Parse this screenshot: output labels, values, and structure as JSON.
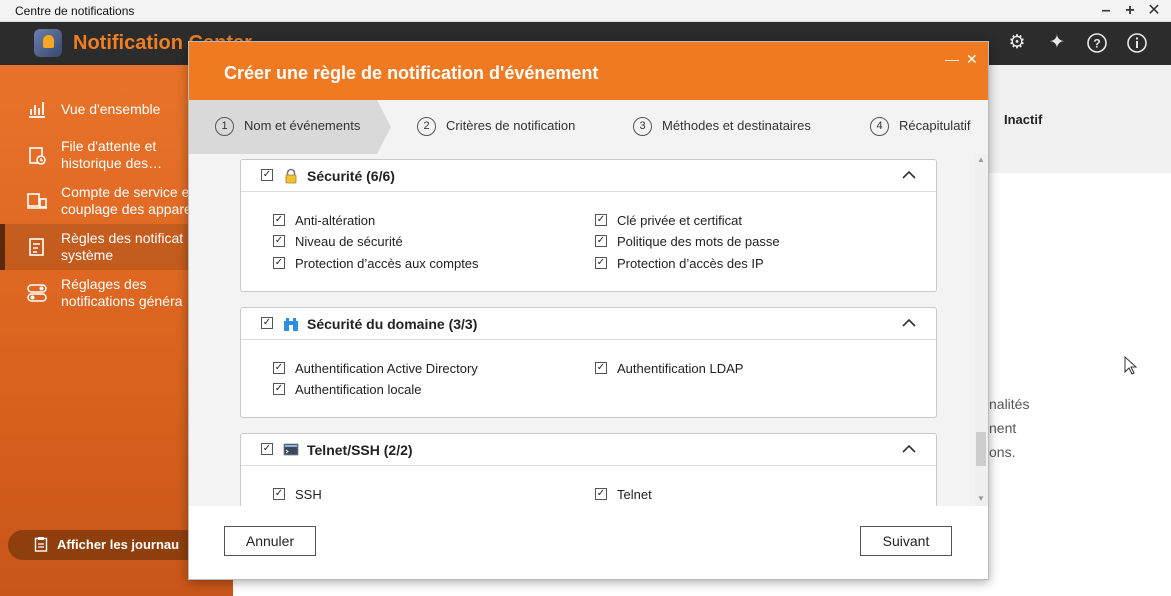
{
  "window": {
    "title": "Centre de notifications"
  },
  "app": {
    "name": "Notification Center"
  },
  "header_icons": [
    "gear-icon",
    "magic-wand-icon",
    "help-icon",
    "info-icon"
  ],
  "sidebar": {
    "items": [
      {
        "label": "Vue d'ensemble",
        "icon": "chart-icon"
      },
      {
        "label": "File d'attente et\nhistorique des…",
        "icon": "history-icon"
      },
      {
        "label": "Compte de service e\ncouplage des appare",
        "icon": "device-icon"
      },
      {
        "label": "Règles des notificat\nsystème",
        "icon": "rules-icon"
      },
      {
        "label": "Réglages des\nnotifications généra",
        "icon": "toggle-icon"
      }
    ],
    "logs_button": "Afficher les journau"
  },
  "main": {
    "status": "Inactif",
    "partial_text": [
      "nalités",
      "nent",
      "ons."
    ]
  },
  "modal": {
    "title": "Créer une règle de notification d'événement",
    "steps": [
      {
        "num": "1",
        "label": "Nom et événements"
      },
      {
        "num": "2",
        "label": "Critères de notification"
      },
      {
        "num": "3",
        "label": "Méthodes et destinataires"
      },
      {
        "num": "4",
        "label": "Récapitulatif"
      }
    ],
    "groups": [
      {
        "title": "Sécurité (6/6)",
        "icon": "lock-icon",
        "items": [
          "Anti-altération",
          "Clé privée et certificat",
          "Niveau de sécurité",
          "Politique des mots de passe",
          "Protection d’accès aux comptes",
          "Protection d’accès des IP"
        ]
      },
      {
        "title": "Sécurité du domaine (3/3)",
        "icon": "domain-icon",
        "items": [
          "Authentification Active Directory",
          "Authentification LDAP",
          "Authentification locale"
        ]
      },
      {
        "title": "Telnet/SSH (2/2)",
        "icon": "terminal-icon",
        "items": [
          "SSH",
          "Telnet"
        ]
      }
    ],
    "cancel": "Annuler",
    "next": "Suivant"
  },
  "colors": {
    "accent": "#f07a22",
    "sidebar": "#e06a24",
    "header": "#2c2c2c"
  }
}
